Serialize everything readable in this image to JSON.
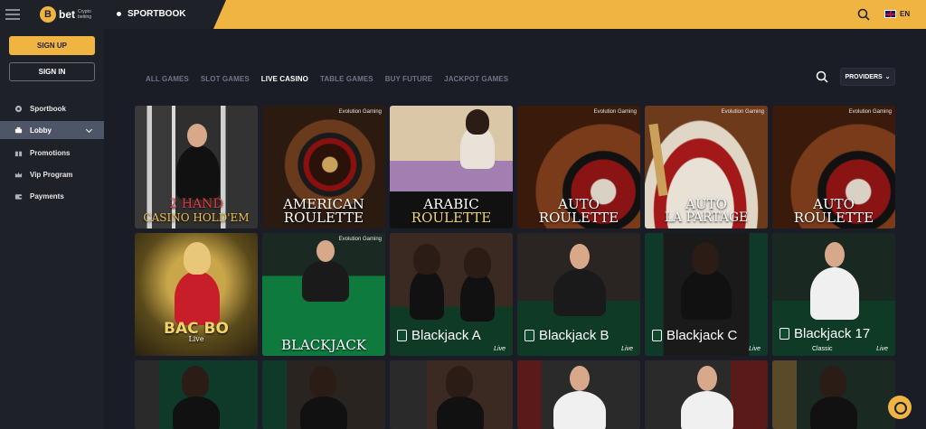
{
  "header": {
    "logo_bet": "bet",
    "logo_coin": "B",
    "logo_tagline": "Crypto betting",
    "sportbook": "SPORTBOOK",
    "language": "EN"
  },
  "sidebar": {
    "signup": "SIGN UP",
    "signin": "SIGN IN",
    "items": [
      {
        "label": "Sportbook",
        "icon": "football-icon"
      },
      {
        "label": "Lobby",
        "icon": "lobby-icon",
        "active": true
      },
      {
        "label": "Promotions",
        "icon": "gift-icon"
      },
      {
        "label": "Vip Program",
        "icon": "crown-icon"
      },
      {
        "label": "Payments",
        "icon": "wallet-icon"
      }
    ]
  },
  "tabs": [
    {
      "label": "ALL GAMES"
    },
    {
      "label": "SLOT GAMES"
    },
    {
      "label": "LIVE CASINO",
      "active": true
    },
    {
      "label": "TABLE GAMES"
    },
    {
      "label": "BUY FUTURE"
    },
    {
      "label": "JACKPOT GAMES"
    }
  ],
  "providers_label": "PROVIDERS",
  "games": [
    {
      "title_line1": "2 HAND",
      "title_line2": "CASINO HOLD'EM"
    },
    {
      "title_line1": "AMERICAN",
      "title_line2": "ROULETTE",
      "badge": "Evolution Gaming"
    },
    {
      "title_line1": "ARABIC",
      "title_line2": "ROULETTE"
    },
    {
      "title_line1": "AUTO",
      "title_line2": "ROULETTE",
      "badge": "Evolution Gaming"
    },
    {
      "title_line1": "AUTO",
      "title_line2": "LA PARTAGE",
      "badge": "Evolution Gaming"
    },
    {
      "title_line1": "AUTO",
      "title_line2": "ROULETTE",
      "badge": "Evolution Gaming"
    },
    {
      "title_line1": "BAC BO",
      "title_line2": "Live"
    },
    {
      "title_line1": "",
      "title_line2": "BLACKJACK",
      "badge": "Evolution Gaming"
    },
    {
      "title": "Blackjack A",
      "sub": "Live"
    },
    {
      "title": "Blackjack B",
      "sub": "Live"
    },
    {
      "title": "Blackjack C",
      "sub": "Live"
    },
    {
      "title": "Blackjack 17",
      "sub": "Live",
      "sub2": "Classic"
    }
  ],
  "colors": {
    "accent": "#f0b443",
    "background": "#1b1d26",
    "sidebar": "#1f2129",
    "nav_active": "#4d5566"
  }
}
